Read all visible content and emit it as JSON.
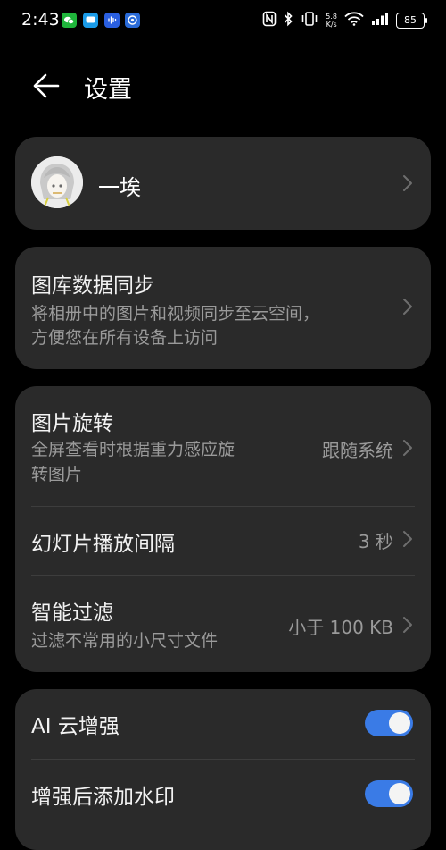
{
  "status_bar": {
    "time": "2:43",
    "net_speed_value": "5.8",
    "net_speed_unit": "K/s",
    "battery": "85",
    "notification_icons": [
      "wechat-icon",
      "message-icon",
      "voice-memo-icon",
      "app-icon"
    ],
    "system_icons": [
      "nfc-icon",
      "bluetooth-icon",
      "vibrate-icon",
      "wifi-icon",
      "signal-icon"
    ]
  },
  "header": {
    "title": "设置"
  },
  "account": {
    "name": "一埃"
  },
  "sync_card": {
    "title": "图库数据同步",
    "subtitle_line1": "将相册中的图片和视频同步至云空间，",
    "subtitle_line2": "方便您在所有设备上访问"
  },
  "display_card": {
    "rotation": {
      "title": "图片旋转",
      "subtitle_line1": "全屏查看时根据重力感应旋",
      "subtitle_line2": "转图片",
      "value": "跟随系统"
    },
    "slideshow": {
      "title": "幻灯片播放间隔",
      "value": "3 秒"
    },
    "smart_filter": {
      "title": "智能过滤",
      "subtitle": "过滤不常用的小尺寸文件",
      "value": "小于 100 KB"
    }
  },
  "ai_card": {
    "ai_enhance": {
      "title": "AI 云增强",
      "enabled": true
    },
    "watermark": {
      "title": "增强后添加水印",
      "enabled": true
    }
  },
  "colors": {
    "accent": "#3a7be6",
    "card": "#2a2a2a",
    "background": "#000000"
  }
}
